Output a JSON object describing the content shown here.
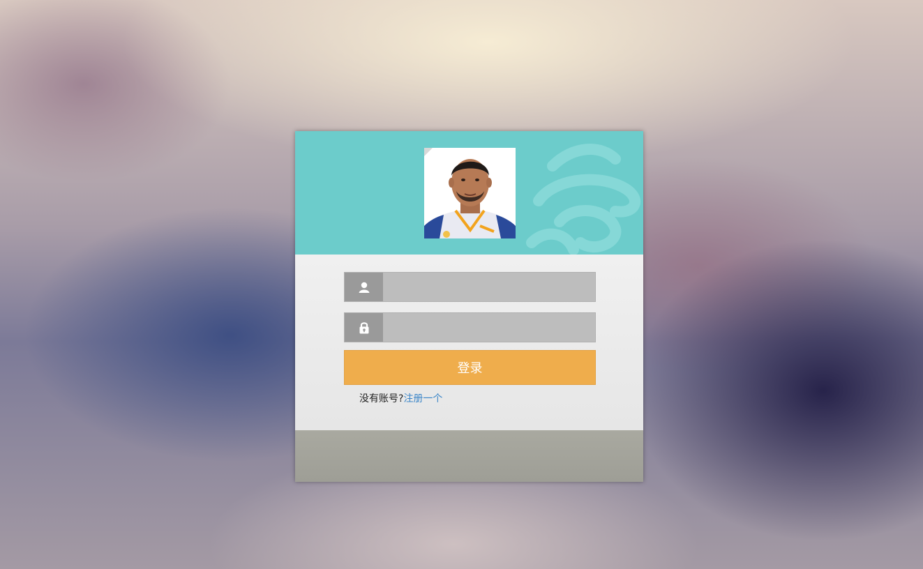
{
  "login": {
    "username_placeholder": "",
    "password_placeholder": "",
    "submit_label": "登录",
    "no_account_text": "没有账号?",
    "register_link_text": "注册一个"
  },
  "icons": {
    "user": "user-icon",
    "lock": "lock-icon"
  },
  "colors": {
    "header": "#6ccccb",
    "button": "#efad4c",
    "link": "#3a85c8"
  }
}
